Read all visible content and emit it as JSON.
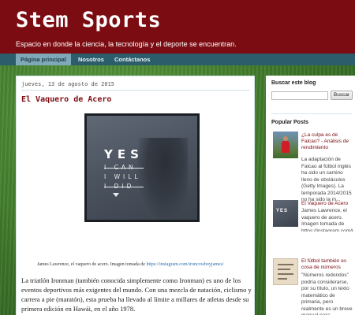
{
  "header": {
    "site_title": "Stem Sports",
    "description": "Espacio en donde la ciencia, la tecnología y el deporte se encuentran."
  },
  "nav": {
    "tabs": [
      {
        "label": "Página principal",
        "active": true
      },
      {
        "label": "Nosotros",
        "active": false
      },
      {
        "label": "Contáctanos",
        "active": false
      }
    ]
  },
  "post": {
    "date": "jueves, 13 de agosto de 2015",
    "title": "El Vaquero de Acero",
    "image_text": {
      "headline": "YES",
      "line1": "I CAN",
      "line2": "I WILL",
      "line3": "I DID"
    },
    "caption_text": "James Lawrence, el vaquero de acero. Imagen tomada de ",
    "caption_link": "https://instagram.com/ironcowboyjames/",
    "body": "La triatlón Ironman (también conocida simplemente como Ironman) es uno de los eventos deportivos más exigentes del mundo. Con una mezcla de natación, ciclismo y carrera a pie (maratón), esta prueba ha llevado al límite a millares de atletas desde su primera edición en Hawái, en el año 1978."
  },
  "sidebar": {
    "search": {
      "title": "Buscar este blog",
      "input_value": "",
      "button_label": "Buscar"
    },
    "popular": {
      "title": "Popular Posts",
      "items": [
        {
          "title": "¿La culpa es de Falcao? - Análisis de rendimiento",
          "snippet": "La adaptación de Falcao al fútbol inglés ha sido un camino lleno de obstáculos (Getty Images). La temporada 2014/2015 no ha sido la m..."
        },
        {
          "title": "El Vaquero de Acero",
          "snippet": "James Lawrence, el vaquero de acero. Imagen tomada de https://instagram.com/ironcowboyjames/ La triatlón Ironman (también conocida sim..."
        },
        {
          "title": "El fútbol también es cosa de números",
          "snippet": "\"Números redondos\" podría considerarse, por su título, un texto matemático de primaria, pero realmente es un breve manual para entender..."
        }
      ]
    }
  },
  "colors": {
    "header_bg": "#7b0d12",
    "nav_bg": "#2b5d6b",
    "title_color": "#7b0d12",
    "link_color": "#2b6cb0"
  }
}
